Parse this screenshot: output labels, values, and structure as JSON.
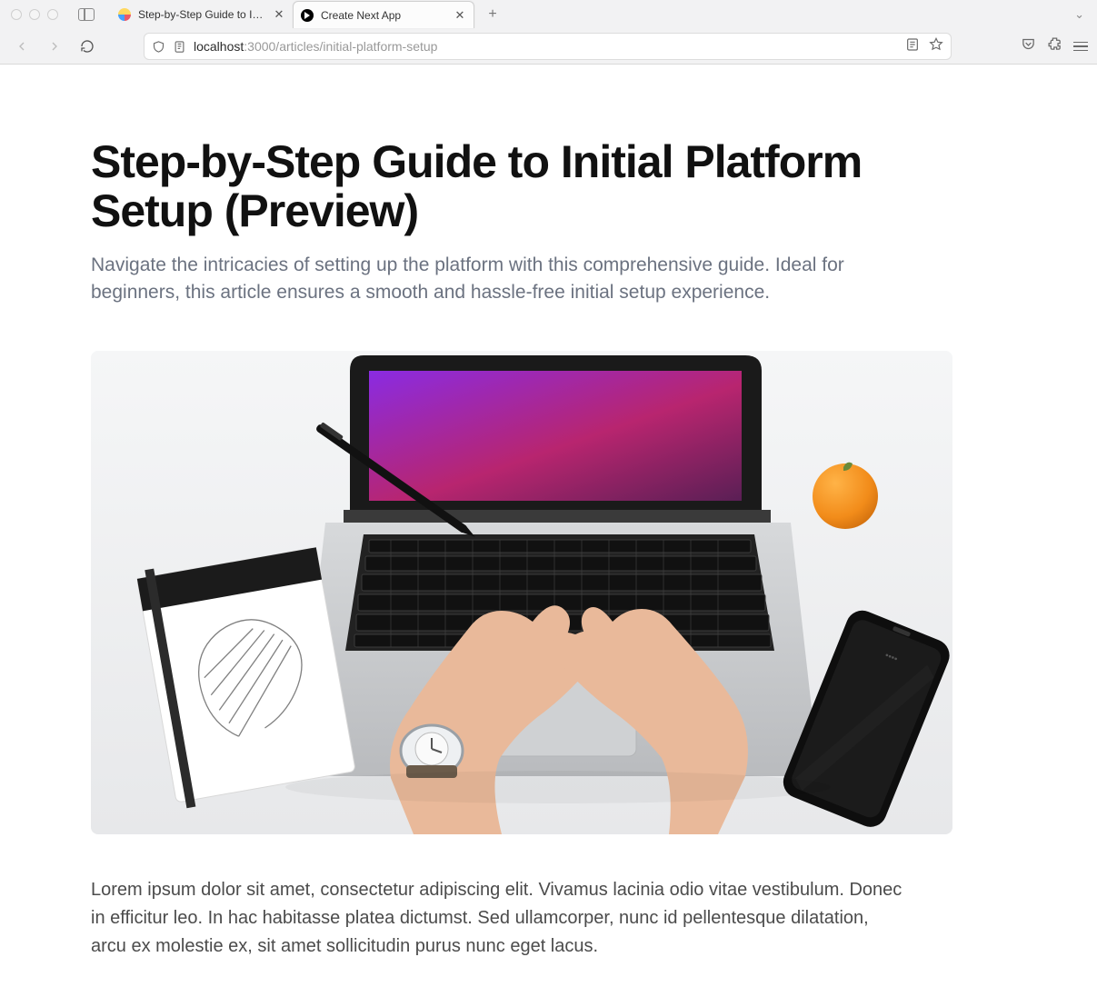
{
  "browser": {
    "tabs": [
      {
        "label": "Step-by-Step Guide to Initial Pl…",
        "active": false
      },
      {
        "label": "Create Next App",
        "active": true
      }
    ],
    "url_host": "localhost",
    "url_path": ":3000/articles/initial-platform-setup"
  },
  "article": {
    "title": "Step-by-Step Guide to Initial Platform Setup (Preview)",
    "subtitle": "Navigate the intricacies of setting up the platform with this comprehensive guide. Ideal for beginners, this article ensures a smooth and hassle-free initial setup experience.",
    "body_p1": "Lorem ipsum dolor sit amet, consectetur adipiscing elit. Vivamus lacinia odio vitae vestibulum. Donec in efficitur leo. In hac habitasse platea dictumst. Sed ullamcorper, nunc id pellentesque dilatation, arcu ex molestie ex, sit amet sollicitudin purus nunc eget lacus.",
    "hero_alt": "Overhead photo of hands typing on a laptop on a white desk, with a notebook, pen, orange, and smartphone nearby"
  }
}
